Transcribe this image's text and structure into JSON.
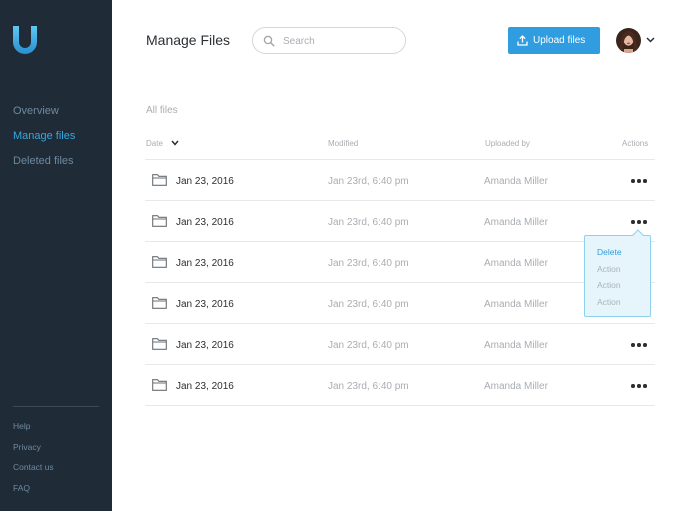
{
  "sidebar": {
    "nav": [
      {
        "label": "Overview",
        "active": false
      },
      {
        "label": "Manage files",
        "active": true
      },
      {
        "label": "Deleted files",
        "active": false
      }
    ],
    "footer": [
      "Help",
      "Privacy",
      "Contact us",
      "FAQ"
    ]
  },
  "header": {
    "title": "Manage Files",
    "search_placeholder": "Search",
    "upload_label": "Upload files"
  },
  "section": {
    "title": "All files",
    "columns": {
      "date": "Date",
      "modified": "Modified",
      "uploaded_by": "Uploaded by",
      "actions": "Actions"
    }
  },
  "rows": [
    {
      "date": "Jan 23, 2016",
      "modified": "Jan 23rd, 6:40 pm",
      "uploaded_by": "Amanda Miller"
    },
    {
      "date": "Jan 23, 2016",
      "modified": "Jan 23rd, 6:40 pm",
      "uploaded_by": "Amanda Miller"
    },
    {
      "date": "Jan 23, 2016",
      "modified": "Jan 23rd, 6:40 pm",
      "uploaded_by": "Amanda Miller"
    },
    {
      "date": "Jan 23, 2016",
      "modified": "Jan 23rd, 6:40 pm",
      "uploaded_by": "Amanda Miller"
    },
    {
      "date": "Jan 23, 2016",
      "modified": "Jan 23rd, 6:40 pm",
      "uploaded_by": "Amanda Miller"
    },
    {
      "date": "Jan 23, 2016",
      "modified": "Jan 23rd, 6:40 pm",
      "uploaded_by": "Amanda Miller"
    }
  ],
  "dropdown": {
    "items": [
      "Delete",
      "Action",
      "Action",
      "Action"
    ]
  },
  "colors": {
    "sidebar_bg": "#1f2b37",
    "accent": "#2f9de0",
    "active_nav": "#35a8e0"
  },
  "icons": {
    "logo": "u-logo-icon",
    "search": "search-icon",
    "upload": "upload-icon",
    "folder": "folder-icon",
    "more": "more-dots-icon",
    "caret": "chevron-down-icon"
  }
}
